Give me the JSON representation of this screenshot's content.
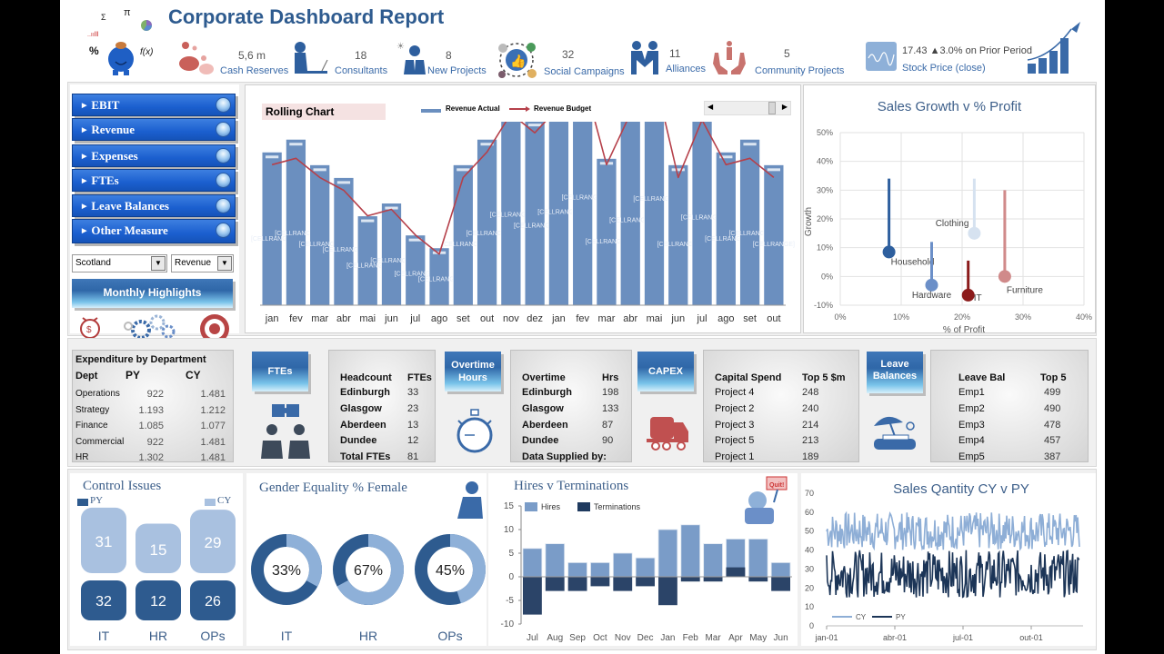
{
  "header": {
    "title": "Corporate Dashboard Report",
    "kpis": [
      {
        "icon": "piggy-bank-icon",
        "value": "5,6 m",
        "label": "Cash Reserves"
      },
      {
        "icon": "consultant-icon",
        "value": "18",
        "label": "Consultants"
      },
      {
        "icon": "idea-person-icon",
        "value": "8",
        "label": "New Projects"
      },
      {
        "icon": "social-thumbs-up-icon",
        "value": "32",
        "label": "Social Campaigns"
      },
      {
        "icon": "handshake-icon",
        "value": "11",
        "label": "Alliances"
      },
      {
        "icon": "community-hands-icon",
        "value": "5",
        "label": "Community Projects"
      },
      {
        "icon": "stock-chart-icon",
        "value": "17.43 ▲3.0% on Prior Period",
        "label": "Stock Price (close)"
      }
    ]
  },
  "sidebar": {
    "nav": [
      {
        "label": "EBIT"
      },
      {
        "label": "Revenue"
      },
      {
        "label": "Expenses"
      },
      {
        "label": "FTEs"
      },
      {
        "label": "Leave Balances"
      },
      {
        "label": "Other Measure"
      }
    ],
    "region_select": "Scotland",
    "measure_select": "Revenue",
    "highlights_button": "Monthly Highlights",
    "expenditure": {
      "title": "Expenditure by Department",
      "headers": [
        "Dept",
        "PY",
        "CY"
      ],
      "rows": [
        [
          "Operations",
          "922",
          "1.481"
        ],
        [
          "Strategy",
          "1.193",
          "1.212"
        ],
        [
          "Finance",
          "1.085",
          "1.077"
        ],
        [
          "Commercial",
          "922",
          "1.481"
        ],
        [
          "HR",
          "1.302",
          "1.481"
        ]
      ]
    }
  },
  "rolling": {
    "title": "Rolling Chart",
    "legend_actual": "Revenue Actual",
    "legend_budget": "Revenue Budget",
    "data_label": "[CELLRANGE]",
    "slider_position": 0.85
  },
  "scatter": {
    "title": "Sales Growth v % Profit",
    "xlabel": "% of Profit",
    "ylabel": "Growth"
  },
  "tiles": {
    "ftes": {
      "banner": "FTEs",
      "headers": [
        "Headcount",
        "FTEs"
      ],
      "rows": [
        [
          "Edinburgh",
          "33"
        ],
        [
          "Glasgow",
          "23"
        ],
        [
          "Aberdeen",
          "13"
        ],
        [
          "Dundee",
          "12"
        ],
        [
          "Total FTEs",
          "81"
        ]
      ]
    },
    "overtime": {
      "banner": "Overtime Hours",
      "headers": [
        "Overtime",
        "Hrs"
      ],
      "rows": [
        [
          "Edinburgh",
          "198"
        ],
        [
          "Glasgow",
          "133"
        ],
        [
          "Aberdeen",
          "87"
        ],
        [
          "Dundee",
          "90"
        ],
        [
          "Data Supplied by:",
          ""
        ]
      ]
    },
    "capex": {
      "banner": "CAPEX",
      "headers": [
        "Capital Spend",
        "Top 5 $m"
      ],
      "rows": [
        [
          "Project 4",
          "248"
        ],
        [
          "Project 2",
          "240"
        ],
        [
          "Project 3",
          "214"
        ],
        [
          "Project 5",
          "213"
        ],
        [
          "Project 1",
          "189"
        ]
      ]
    },
    "leave": {
      "banner": "Leave Balances",
      "headers": [
        "Leave Bal",
        "Top 5"
      ],
      "rows": [
        [
          "Emp1",
          "499"
        ],
        [
          "Emp2",
          "490"
        ],
        [
          "Emp3",
          "478"
        ],
        [
          "Emp4",
          "457"
        ],
        [
          "Emp5",
          "387"
        ]
      ]
    }
  },
  "control": {
    "title": "Control Issues",
    "legend_py": "PY",
    "legend_cy": "CY",
    "colors": {
      "py": "#2e5b8f",
      "cy": "#a9c1e0"
    }
  },
  "gender": {
    "title": "Gender Equality % Female"
  },
  "hires": {
    "title": "Hires v Terminations"
  },
  "sales_qty": {
    "title": "Sales Qantity CY v PY"
  },
  "chart_data": [
    {
      "name": "rolling-chart",
      "type": "bar",
      "title": "Rolling Chart",
      "categories": [
        "jan",
        "fev",
        "mar",
        "abr",
        "mai",
        "jun",
        "jul",
        "ago",
        "set",
        "out",
        "nov",
        "dez",
        "jan",
        "fev",
        "mar",
        "abr",
        "mai",
        "jun",
        "jul",
        "ago",
        "set",
        "out"
      ],
      "series": [
        {
          "name": "Revenue Actual",
          "type": "bar",
          "color": "#6b8fbf",
          "values": [
            48,
            52,
            44,
            40,
            28,
            32,
            22,
            18,
            44,
            52,
            66,
            58,
            68,
            79,
            46,
            62,
            78,
            44,
            64,
            48,
            52,
            44
          ]
        },
        {
          "name": "Revenue Budget",
          "type": "line",
          "color": "#b5404a",
          "values": [
            44,
            46,
            40,
            36,
            28,
            30,
            22,
            16,
            40,
            48,
            60,
            54,
            62,
            72,
            44,
            60,
            72,
            40,
            58,
            44,
            46,
            40
          ]
        }
      ],
      "ylim": [
        0,
        100
      ]
    },
    {
      "name": "sales-growth-scatter",
      "type": "scatter",
      "title": "Sales Growth v % Profit",
      "xlabel": "% of Profit",
      "ylabel": "Growth",
      "xlim": [
        0,
        40
      ],
      "ylim": [
        -10,
        50
      ],
      "xticks": [
        "0%",
        "10%",
        "20%",
        "30%",
        "40%"
      ],
      "yticks": [
        "-10%",
        "0%",
        "10%",
        "20%",
        "30%",
        "40%",
        "50%"
      ],
      "points": [
        {
          "label": "Household",
          "x": 8,
          "y": 8.5,
          "stem_top": 34,
          "color": "#2e5f9e"
        },
        {
          "label": "Hardware",
          "x": 15,
          "y": -3,
          "stem_top": 12,
          "color": "#6b8fc8"
        },
        {
          "label": "Clothing",
          "x": 22,
          "y": 15,
          "stem_top": 34,
          "color": "#d6e2f0"
        },
        {
          "label": "IT",
          "x": 21,
          "y": -6.5,
          "stem_top": 5.5,
          "color": "#8b1a1a"
        },
        {
          "label": "Furniture",
          "x": 27,
          "y": 0,
          "stem_top": 30,
          "color": "#d08a8a"
        }
      ]
    },
    {
      "name": "control-issues",
      "type": "bar",
      "title": "Control Issues",
      "categories": [
        "IT",
        "HR",
        "OPs"
      ],
      "series": [
        {
          "name": "CY",
          "values": [
            31,
            15,
            29
          ]
        },
        {
          "name": "PY",
          "values": [
            32,
            12,
            26
          ]
        }
      ]
    },
    {
      "name": "gender-equality",
      "type": "pie",
      "title": "Gender Equality % Female",
      "categories": [
        "IT",
        "HR",
        "OPs"
      ],
      "values": [
        33,
        67,
        45
      ],
      "labels": [
        "33%",
        "67%",
        "45%"
      ]
    },
    {
      "name": "hires-v-terminations",
      "type": "bar",
      "title": "Hires v Terminations",
      "categories": [
        "Jul",
        "Aug",
        "Sep",
        "Oct",
        "Nov",
        "Dec",
        "Jan",
        "Feb",
        "Mar",
        "Apr",
        "May",
        "Jun"
      ],
      "series": [
        {
          "name": "Hires",
          "color": "#7a9cc8",
          "values": [
            6,
            7,
            3,
            3,
            5,
            4,
            10,
            11,
            7,
            8,
            8,
            3
          ]
        },
        {
          "name": "Terminations",
          "color": "#1f3a5f",
          "values": [
            -8,
            -3,
            -3,
            -2,
            -3,
            -2,
            -6,
            -1,
            -1,
            2,
            -1,
            -3
          ]
        }
      ],
      "ylim": [
        -10,
        15
      ],
      "yticks": [
        -10,
        -5,
        0,
        5,
        10,
        15
      ]
    },
    {
      "name": "sales-quantity",
      "type": "line",
      "title": "Sales Qantity CY v PY",
      "xticks": [
        "jan-01",
        "abr-01",
        "jul-01",
        "out-01"
      ],
      "yticks": [
        0,
        10,
        20,
        30,
        40,
        50,
        60,
        70
      ],
      "ylim": [
        0,
        70
      ],
      "series": [
        {
          "name": "CY",
          "color": "#8eaed6",
          "range": [
            40,
            60
          ]
        },
        {
          "name": "PY",
          "color": "#1c3557",
          "range": [
            15,
            40
          ]
        }
      ]
    }
  ]
}
